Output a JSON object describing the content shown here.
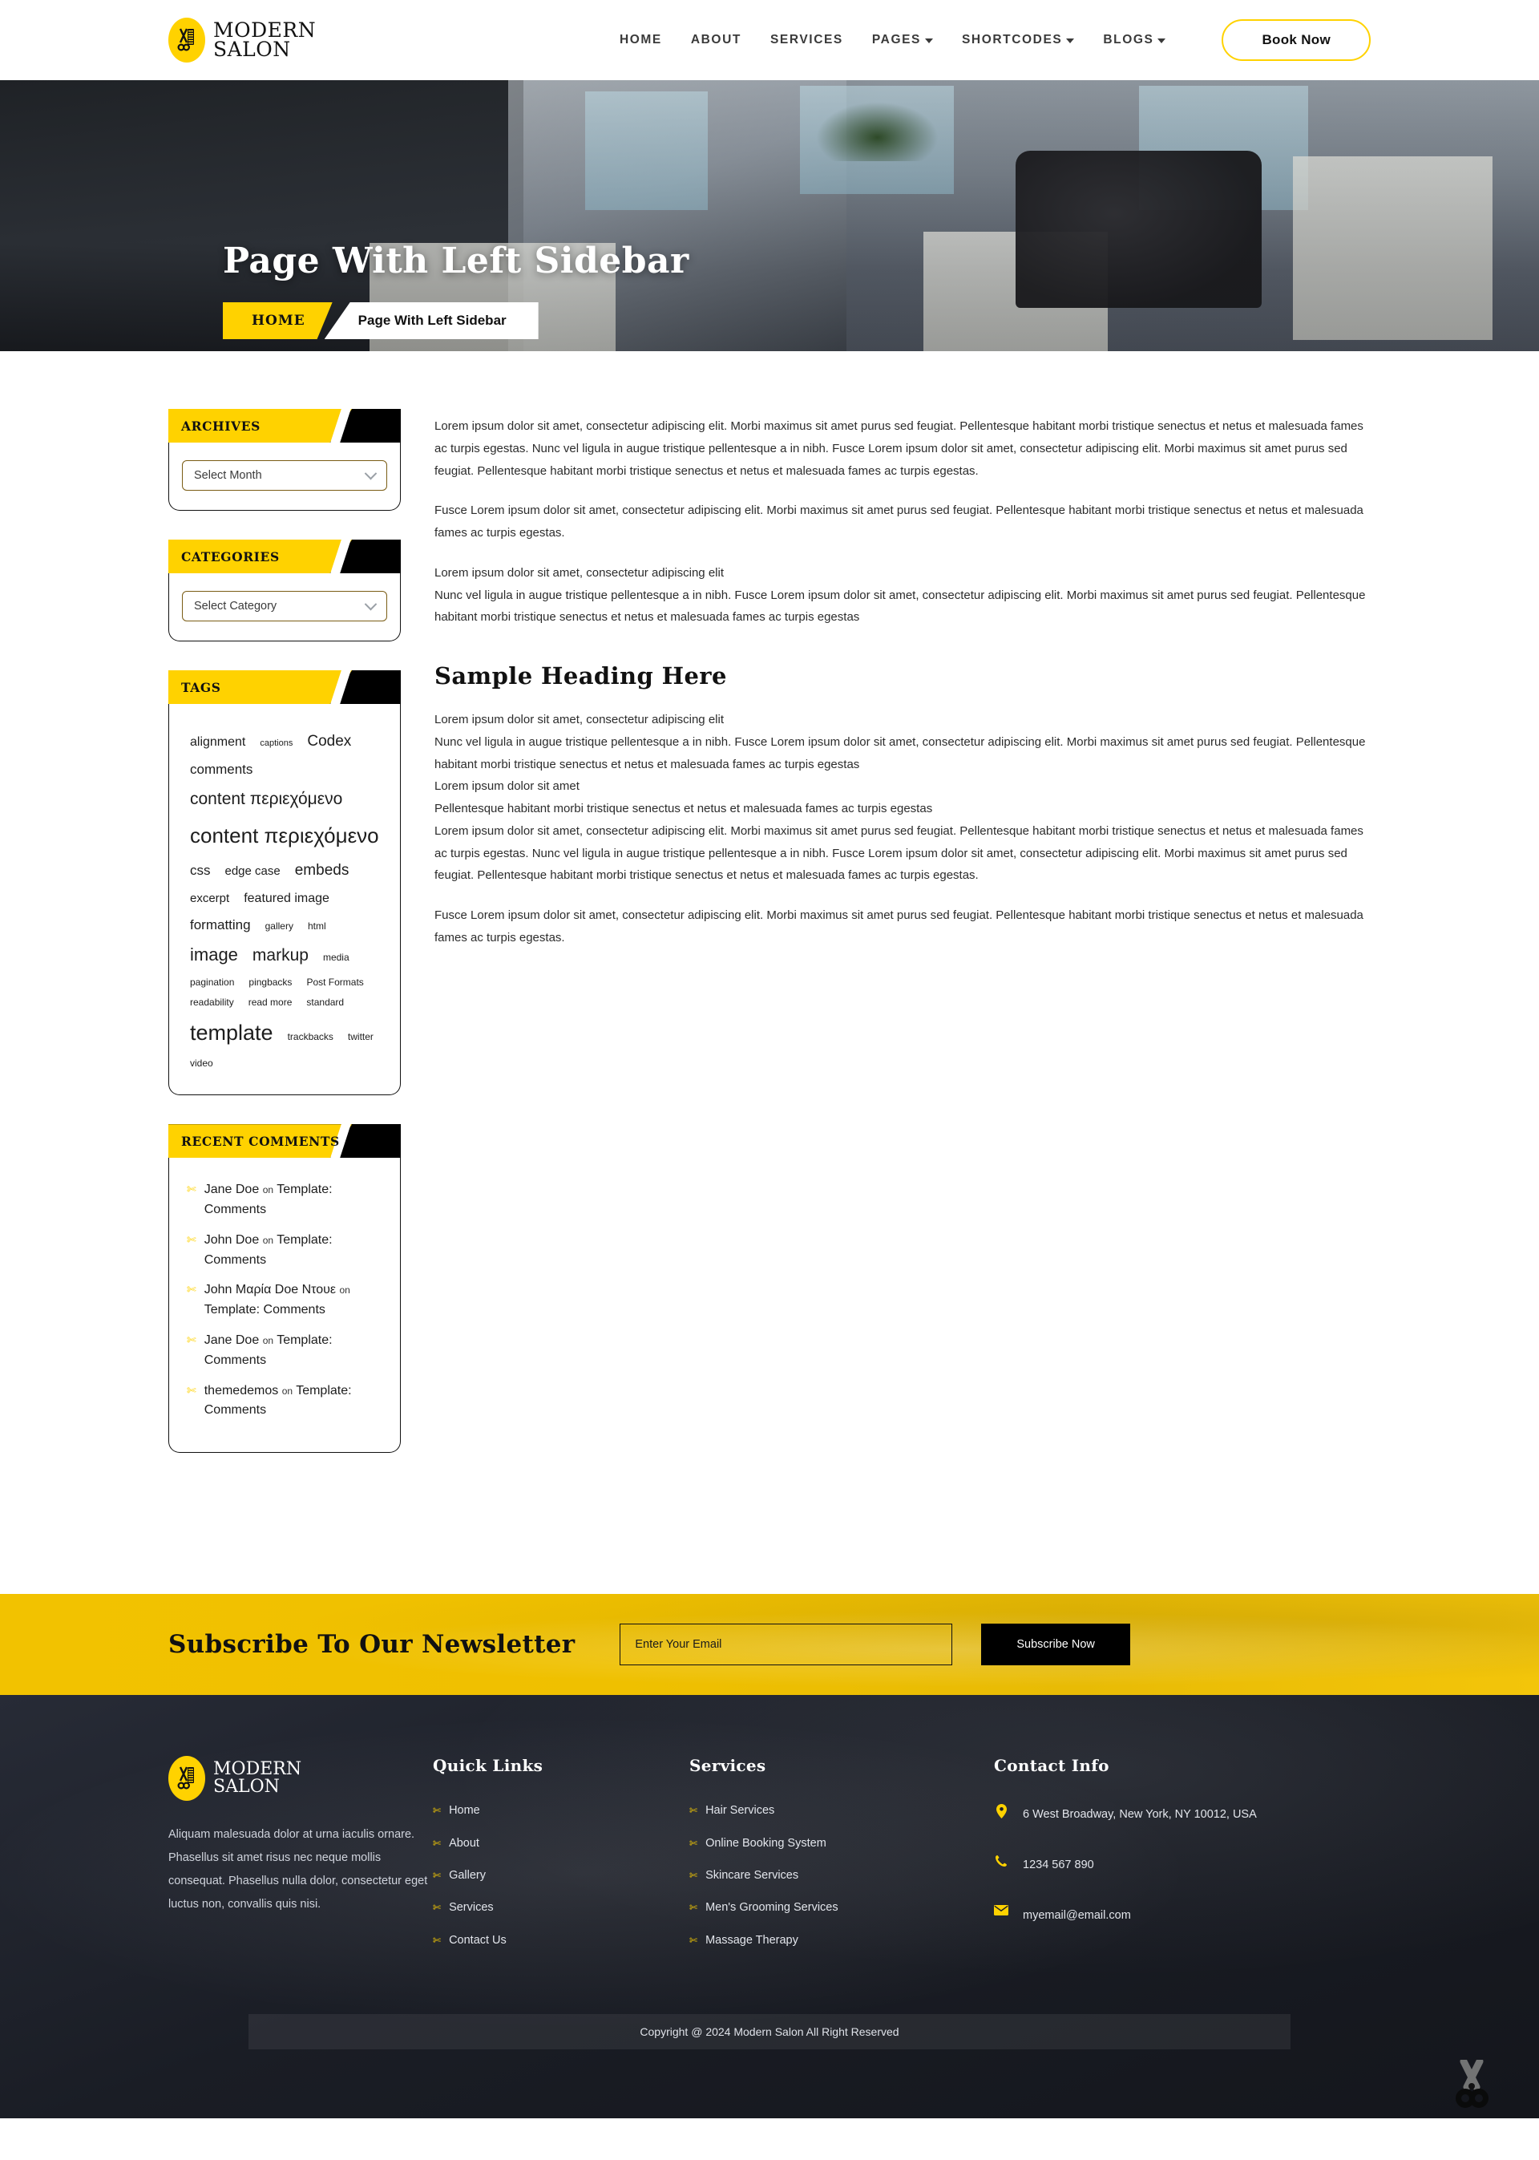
{
  "brand": {
    "name_line1": "MODERN",
    "name_line2": "SALON",
    "logo_icon": "scissors-comb-icon"
  },
  "header": {
    "nav": [
      {
        "label": "HOME",
        "has_dropdown": false
      },
      {
        "label": "ABOUT",
        "has_dropdown": false
      },
      {
        "label": "SERVICES",
        "has_dropdown": false
      },
      {
        "label": "PAGES",
        "has_dropdown": true
      },
      {
        "label": "SHORTCODES",
        "has_dropdown": true
      },
      {
        "label": "BLOGS",
        "has_dropdown": true
      }
    ],
    "cta_label": "Book Now"
  },
  "hero": {
    "title": "Page With Left Sidebar",
    "breadcrumb_home": "HOME",
    "breadcrumb_current": "Page With Left Sidebar"
  },
  "sidebar": {
    "archives": {
      "title": "ARCHIVES",
      "select_value": "Select Month"
    },
    "categories": {
      "title": "CATEGORIES",
      "select_value": "Select Category"
    },
    "tags": {
      "title": "TAGS",
      "items": [
        {
          "label": "alignment",
          "size": 16
        },
        {
          "label": "captions",
          "size": 11
        },
        {
          "label": "Codex",
          "size": 19
        },
        {
          "label": "comments",
          "size": 17
        },
        {
          "label": "content περιεχόμενο",
          "size": 21
        },
        {
          "label": "content περιεχόμενο",
          "size": 26
        },
        {
          "label": "css",
          "size": 17
        },
        {
          "label": "edge case",
          "size": 15
        },
        {
          "label": "embeds",
          "size": 19
        },
        {
          "label": "excerpt",
          "size": 15
        },
        {
          "label": "featured image",
          "size": 16
        },
        {
          "label": "formatting",
          "size": 17
        },
        {
          "label": "gallery",
          "size": 12
        },
        {
          "label": "html",
          "size": 12
        },
        {
          "label": "image",
          "size": 22
        },
        {
          "label": "markup",
          "size": 21
        },
        {
          "label": "media",
          "size": 12
        },
        {
          "label": "pagination",
          "size": 12
        },
        {
          "label": "pingbacks",
          "size": 12
        },
        {
          "label": "Post Formats",
          "size": 12
        },
        {
          "label": "readability",
          "size": 12
        },
        {
          "label": "read more",
          "size": 12
        },
        {
          "label": "standard",
          "size": 12
        },
        {
          "label": "template",
          "size": 27
        },
        {
          "label": "trackbacks",
          "size": 12
        },
        {
          "label": "twitter",
          "size": 12
        },
        {
          "label": "video",
          "size": 12
        }
      ]
    },
    "recent_comments": {
      "title": "RECENT COMMENTS",
      "items": [
        {
          "author": "Jane Doe",
          "on": "on",
          "post": "Template: Comments"
        },
        {
          "author": "John Doe",
          "on": "on",
          "post": "Template: Comments"
        },
        {
          "author": "John Μαρία Doe Ντουε",
          "on": "on",
          "post": "Template: Comments"
        },
        {
          "author": "Jane Doe",
          "on": "on",
          "post": "Template: Comments"
        },
        {
          "author": "themedemos",
          "on": "on",
          "post": "Template: Comments"
        }
      ]
    }
  },
  "main": {
    "paragraph_1": "Lorem ipsum dolor sit amet, consectetur adipiscing elit. Morbi maximus sit amet purus sed feugiat. Pellentesque habitant morbi tristique senectus et netus et malesuada fames ac turpis egestas. Nunc vel ligula in augue tristique pellentesque a in nibh. Fusce Lorem ipsum dolor sit amet, consectetur adipiscing elit. Morbi maximus sit amet purus sed feugiat. Pellentesque habitant morbi tristique senectus et netus et malesuada fames ac turpis egestas.",
    "paragraph_2": "Fusce Lorem ipsum dolor sit amet, consectetur adipiscing elit. Morbi maximus sit amet purus sed feugiat. Pellentesque habitant morbi tristique senectus et netus et malesuada fames ac turpis egestas.",
    "block_1_line_1": "Lorem ipsum dolor sit amet, consectetur adipiscing elit",
    "block_1_line_2": "Nunc vel ligula in augue tristique pellentesque a in nibh. Fusce Lorem ipsum dolor sit amet, consectetur adipiscing elit. Morbi maximus sit amet purus sed feugiat. Pellentesque habitant morbi tristique senectus et netus et malesuada fames ac turpis egestas",
    "heading": "Sample Heading Here",
    "block_2_line_1": "Lorem ipsum dolor sit amet, consectetur adipiscing elit",
    "block_2_line_2": "Nunc vel ligula in augue tristique pellentesque a in nibh. Fusce Lorem ipsum dolor sit amet, consectetur adipiscing elit. Morbi maximus sit amet purus sed feugiat. Pellentesque habitant morbi tristique senectus et netus et malesuada fames ac turpis egestas",
    "block_2_line_3": "Lorem ipsum dolor sit amet",
    "block_2_line_4": "Pellentesque habitant morbi tristique senectus et netus et malesuada fames ac turpis egestas",
    "block_2_line_5": "Lorem ipsum dolor sit amet, consectetur adipiscing elit. Morbi maximus sit amet purus sed feugiat. Pellentesque habitant morbi tristique senectus et netus et malesuada fames ac turpis egestas. Nunc vel ligula in augue tristique pellentesque a in nibh. Fusce Lorem ipsum dolor sit amet, consectetur adipiscing elit. Morbi maximus sit amet purus sed feugiat. Pellentesque habitant morbi tristique senectus et netus et malesuada fames ac turpis egestas.",
    "paragraph_3": "Fusce Lorem ipsum dolor sit amet, consectetur adipiscing elit. Morbi maximus sit amet purus sed feugiat. Pellentesque habitant morbi tristique senectus et netus et malesuada fames ac turpis egestas."
  },
  "newsletter": {
    "title": "Subscribe To Our Newsletter",
    "placeholder": "Enter Your Email",
    "button_label": "Subscribe Now"
  },
  "footer": {
    "about_text": "Aliquam malesuada dolor at urna iaculis ornare. Phasellus sit amet risus nec neque mollis consequat. Phasellus nulla dolor, consectetur eget luctus non, convallis quis nisi.",
    "quick_links": {
      "title": "Quick Links",
      "items": [
        "Home",
        "About",
        "Gallery",
        "Services",
        "Contact Us"
      ]
    },
    "services": {
      "title": "Services",
      "items": [
        "Hair Services",
        "Online Booking System",
        "Skincare Services",
        "Men's Grooming Services",
        "Massage Therapy"
      ]
    },
    "contact": {
      "title": "Contact Info",
      "address": "6 West Broadway, New York, NY 10012, USA",
      "phone": "1234 567 890",
      "email": "myemail@email.com"
    },
    "copyright": "Copyright @ 2024 Modern Salon All Right Reserved"
  },
  "colors": {
    "accent": "#FFD200",
    "dark": "#1c1f27",
    "text": "#2c2c2c"
  }
}
